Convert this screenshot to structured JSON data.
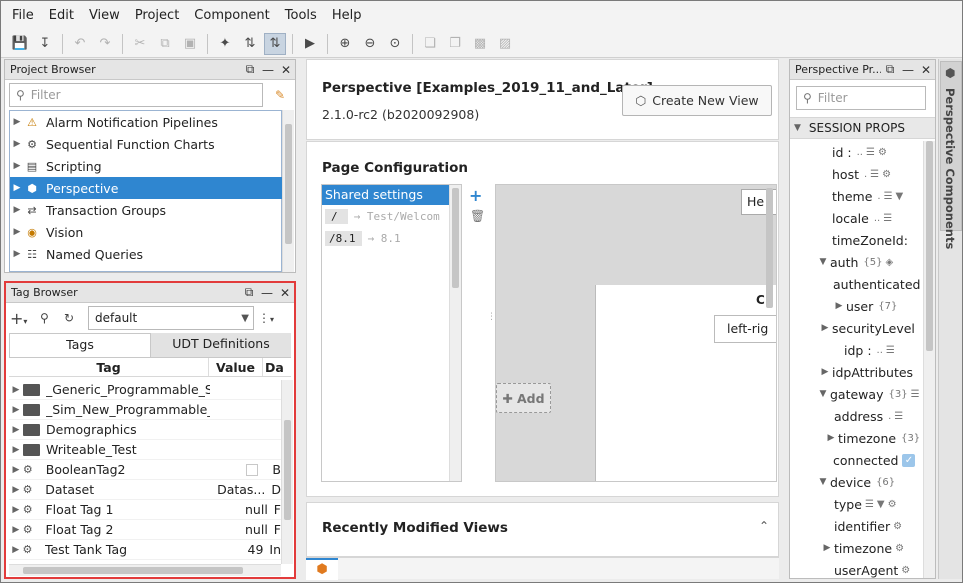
{
  "menu": [
    "File",
    "Edit",
    "View",
    "Project",
    "Component",
    "Tools",
    "Help"
  ],
  "project_browser": {
    "title": "Project Browser",
    "filter_placeholder": "Filter",
    "items": [
      {
        "label": "Alarm Notification Pipelines",
        "icon": "alarm-icon"
      },
      {
        "label": "Sequential Function Charts",
        "icon": "sfc-icon"
      },
      {
        "label": "Scripting",
        "icon": "script-icon"
      },
      {
        "label": "Perspective",
        "icon": "perspective-icon"
      },
      {
        "label": "Transaction Groups",
        "icon": "transaction-icon"
      },
      {
        "label": "Vision",
        "icon": "vision-icon"
      },
      {
        "label": "Named Queries",
        "icon": "query-icon"
      }
    ]
  },
  "tag_browser": {
    "title": "Tag Browser",
    "provider": "default",
    "tabs": [
      "Tags",
      "UDT Definitions"
    ],
    "columns": [
      "Tag",
      "Value",
      "Da"
    ],
    "rows": [
      {
        "name": "_Generic_Programmable_Sim",
        "value": "",
        "dt": "",
        "type": "folder"
      },
      {
        "name": "_Sim_New_Programmable_",
        "value": "",
        "dt": "",
        "type": "folder"
      },
      {
        "name": "Demographics",
        "value": "",
        "dt": "",
        "type": "folder"
      },
      {
        "name": "Writeable_Test",
        "value": "",
        "dt": "",
        "type": "folder"
      },
      {
        "name": "BooleanTag2",
        "value": "",
        "dt": "B",
        "type": "tag"
      },
      {
        "name": "Dataset",
        "value": "Datas...",
        "dt": "D",
        "type": "tag"
      },
      {
        "name": "Float Tag 1",
        "value": "null",
        "dt": "F",
        "type": "tag"
      },
      {
        "name": "Float Tag 2",
        "value": "null",
        "dt": "F",
        "type": "tag"
      },
      {
        "name": "Test Tank Tag",
        "value": "49",
        "dt": "In",
        "type": "tag"
      }
    ]
  },
  "main": {
    "project_title": "Perspective [Examples_2019_11_and_Later]",
    "version": "2.1.0-rc2 (b2020092908)",
    "create_view": "Create New View",
    "page_config_title": "Page Configuration",
    "shared_settings": "Shared settings",
    "routes": [
      {
        "path": "/",
        "target": "→ Test/Welcom"
      },
      {
        "path": "/8.1",
        "target": "→ 8.1"
      }
    ],
    "preview_header": "He",
    "preview_c": "C",
    "preview_left": "left-rig",
    "add_label": "Add",
    "recent_title": "Recently Modified Views"
  },
  "props_panel": {
    "title": "Perspective Pr...",
    "filter_placeholder": "Filter",
    "section": "SESSION PROPS",
    "side_tab": "Perspective Components",
    "rows": [
      {
        "key": "id",
        "suffix": ":",
        "mini": "..",
        "indent": 0
      },
      {
        "key": "host",
        "suffix": "",
        "mini": ".",
        "indent": 0
      },
      {
        "key": "theme",
        "suffix": ".",
        "mini": "",
        "indent": 0
      },
      {
        "key": "locale",
        "suffix": "",
        "mini": "..",
        "indent": 0
      },
      {
        "key": "timeZoneId",
        "suffix": ":",
        "mini": "",
        "indent": 0
      },
      {
        "key": "auth",
        "suffix": "",
        "mini": "{5}",
        "indent": 0
      },
      {
        "key": "authenticated",
        "suffix": "",
        "mini": "",
        "indent": 1
      },
      {
        "key": "user",
        "suffix": "",
        "mini": "{7}",
        "indent": 1
      },
      {
        "key": "securityLevel",
        "suffix": "",
        "mini": "",
        "indent": 1
      },
      {
        "key": "idp",
        "suffix": ":",
        "mini": "..",
        "indent": 2
      },
      {
        "key": "idpAttributes",
        "suffix": "",
        "mini": "",
        "indent": 0
      },
      {
        "key": "gateway",
        "suffix": "",
        "mini": "{3}",
        "indent": 0
      },
      {
        "key": "address",
        "suffix": "",
        "mini": ".",
        "indent": 1
      },
      {
        "key": "timezone",
        "suffix": "",
        "mini": "{3}",
        "indent": 1
      },
      {
        "key": "connected",
        "suffix": "",
        "mini": "",
        "indent": 0
      },
      {
        "key": "device",
        "suffix": "",
        "mini": "{6}",
        "indent": 0
      },
      {
        "key": "type",
        "suffix": "",
        "mini": "",
        "indent": 1
      },
      {
        "key": "identifier",
        "suffix": "",
        "mini": "",
        "indent": 1
      },
      {
        "key": "timezone",
        "suffix": "",
        "mini": "",
        "indent": 1
      },
      {
        "key": "userAgent",
        "suffix": "",
        "mini": "",
        "indent": 1
      }
    ]
  },
  "colors": {
    "accent": "#2f86d0",
    "highlight_border": "#e23b3b"
  }
}
